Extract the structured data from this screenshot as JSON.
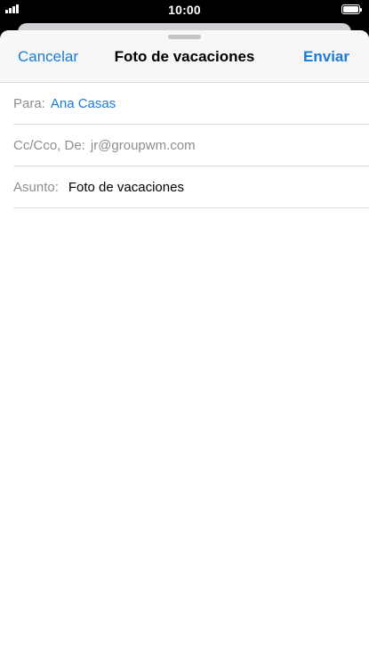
{
  "status_bar": {
    "time": "10:00",
    "signal_icon": "cellular-signal-icon",
    "battery_icon": "battery-full-icon"
  },
  "compose": {
    "cancel_label": "Cancelar",
    "title": "Foto de vacaciones",
    "send_label": "Enviar",
    "to_label": "Para:",
    "to_value": "Ana Casas",
    "cc_label": "Cc/Cco, De:",
    "cc_value": "jr@groupwm.com",
    "subject_label": "Asunto:",
    "subject_value": "Foto de vacaciones",
    "body": ""
  },
  "colors": {
    "accent": "#1a7bd6",
    "secondary_text": "#8e8e93",
    "nav_background": "#f7f7f7"
  }
}
